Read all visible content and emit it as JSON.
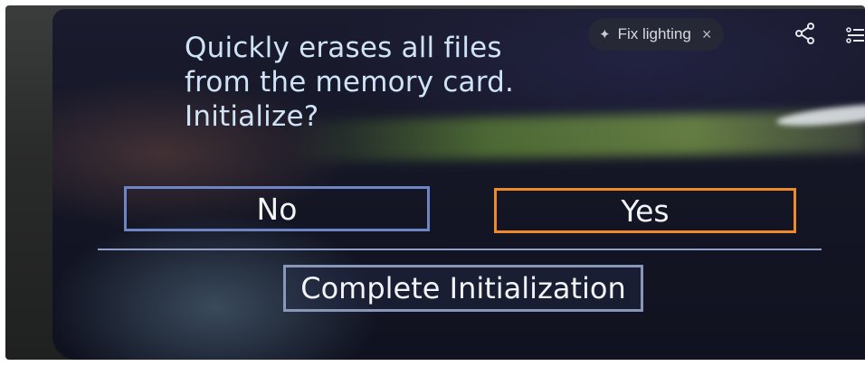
{
  "dialog": {
    "message_lines": [
      "Quickly erases all files",
      "from the memory card.",
      "Initialize?"
    ],
    "no_label": "No",
    "yes_label": "Yes",
    "complete_label": "Complete Initialization"
  },
  "overlay": {
    "fix_lighting_label": "Fix lighting",
    "close_symbol": "×",
    "sparkle_symbol": "✦"
  },
  "icons": {
    "sparkle": "sparkle-icon",
    "close": "close-icon",
    "share": "share-icon",
    "more": "more-icon"
  },
  "colors": {
    "text": "#cfe3f7",
    "no_border": "#6e84c4",
    "yes_border_selected": "#ee8a2a",
    "complete_border": "#8896b8"
  }
}
